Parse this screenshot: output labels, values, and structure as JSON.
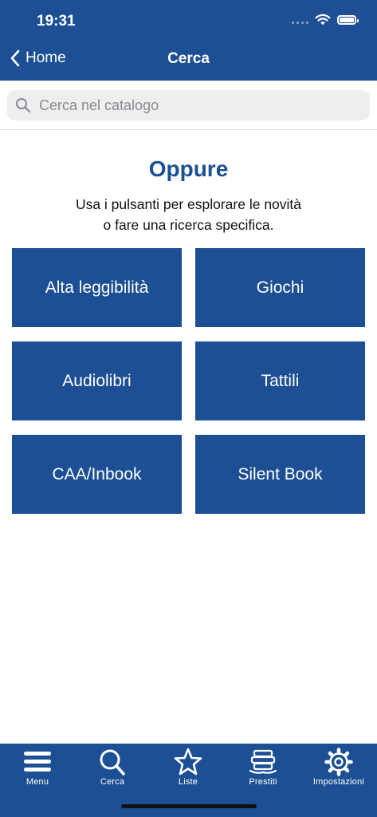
{
  "status_bar": {
    "time": "19:31"
  },
  "nav": {
    "back_label": "Home",
    "title": "Cerca"
  },
  "search": {
    "placeholder": "Cerca nel catalogo",
    "value": ""
  },
  "content": {
    "heading": "Oppure",
    "subtitle_line1": "Usa i pulsanti per esplorare le novità",
    "subtitle_line2": "o fare una ricerca specifica."
  },
  "tiles": [
    "Alta leggibilità",
    "Giochi",
    "Audiolibri",
    "Tattili",
    "CAA/Inbook",
    "Silent Book"
  ],
  "tabbar": {
    "items": [
      {
        "label": "Menu",
        "icon": "menu-icon"
      },
      {
        "label": "Cerca",
        "icon": "search-icon"
      },
      {
        "label": "Liste",
        "icon": "star-icon"
      },
      {
        "label": "Prestiti",
        "icon": "books-stack-icon"
      },
      {
        "label": "Impostazioni",
        "icon": "gear-icon"
      }
    ]
  },
  "colors": {
    "brand": "#1c4f93",
    "background": "#ffffff",
    "search_field": "#eeeef0"
  }
}
